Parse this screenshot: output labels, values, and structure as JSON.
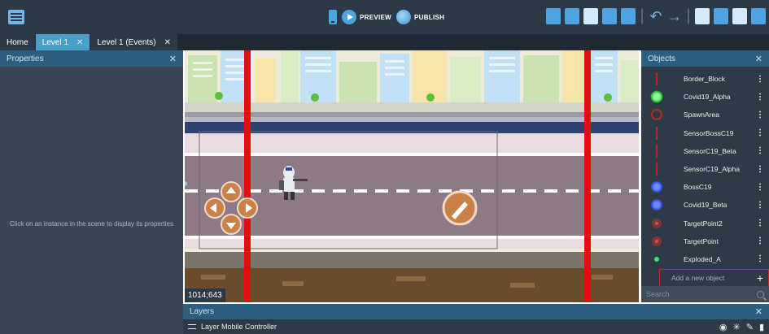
{
  "toolbar": {
    "preview_label": "PREVIEW",
    "publish_label": "PUBLISH"
  },
  "tabs": [
    {
      "label": "Home",
      "active": false,
      "closable": false
    },
    {
      "label": "Level 1",
      "active": true,
      "closable": true
    },
    {
      "label": "Level 1 (Events)",
      "active": false,
      "closable": true
    }
  ],
  "properties": {
    "title": "Properties",
    "empty_message": "Click on an instance in the scene to display its properties"
  },
  "scene": {
    "cursor_coords": "1014;643"
  },
  "objects": {
    "title": "Objects",
    "items": [
      {
        "label": "Border_Block",
        "icon": "red-line-icon"
      },
      {
        "label": "Covid19_Alpha",
        "icon": "green-virus-icon"
      },
      {
        "label": "SpawnArea",
        "icon": "red-ring-icon"
      },
      {
        "label": "SensorBossC19",
        "icon": "red-line-icon"
      },
      {
        "label": "SensorC19_Beta",
        "icon": "red-line-icon"
      },
      {
        "label": "SensorC19_Alpha",
        "icon": "red-line-icon"
      },
      {
        "label": "BossC19",
        "icon": "blue-virus-icon"
      },
      {
        "label": "Covid19_Beta",
        "icon": "blue-virus-icon"
      },
      {
        "label": "TargetPoint2",
        "icon": "target-icon"
      },
      {
        "label": "TargetPoint",
        "icon": "target-icon"
      },
      {
        "label": "Exploded_A",
        "icon": "green-dot-icon"
      }
    ],
    "add_label": "Add a new object",
    "search_placeholder": "Search"
  },
  "layers": {
    "title": "Layers",
    "items": [
      {
        "label": "Layer Mobile Controller"
      }
    ]
  },
  "colors": {
    "toolbar_bg": "#2c3a47",
    "panel_header": "#2c5e80",
    "active_tab": "#4a9fc8",
    "accent_red": "#e01010"
  }
}
